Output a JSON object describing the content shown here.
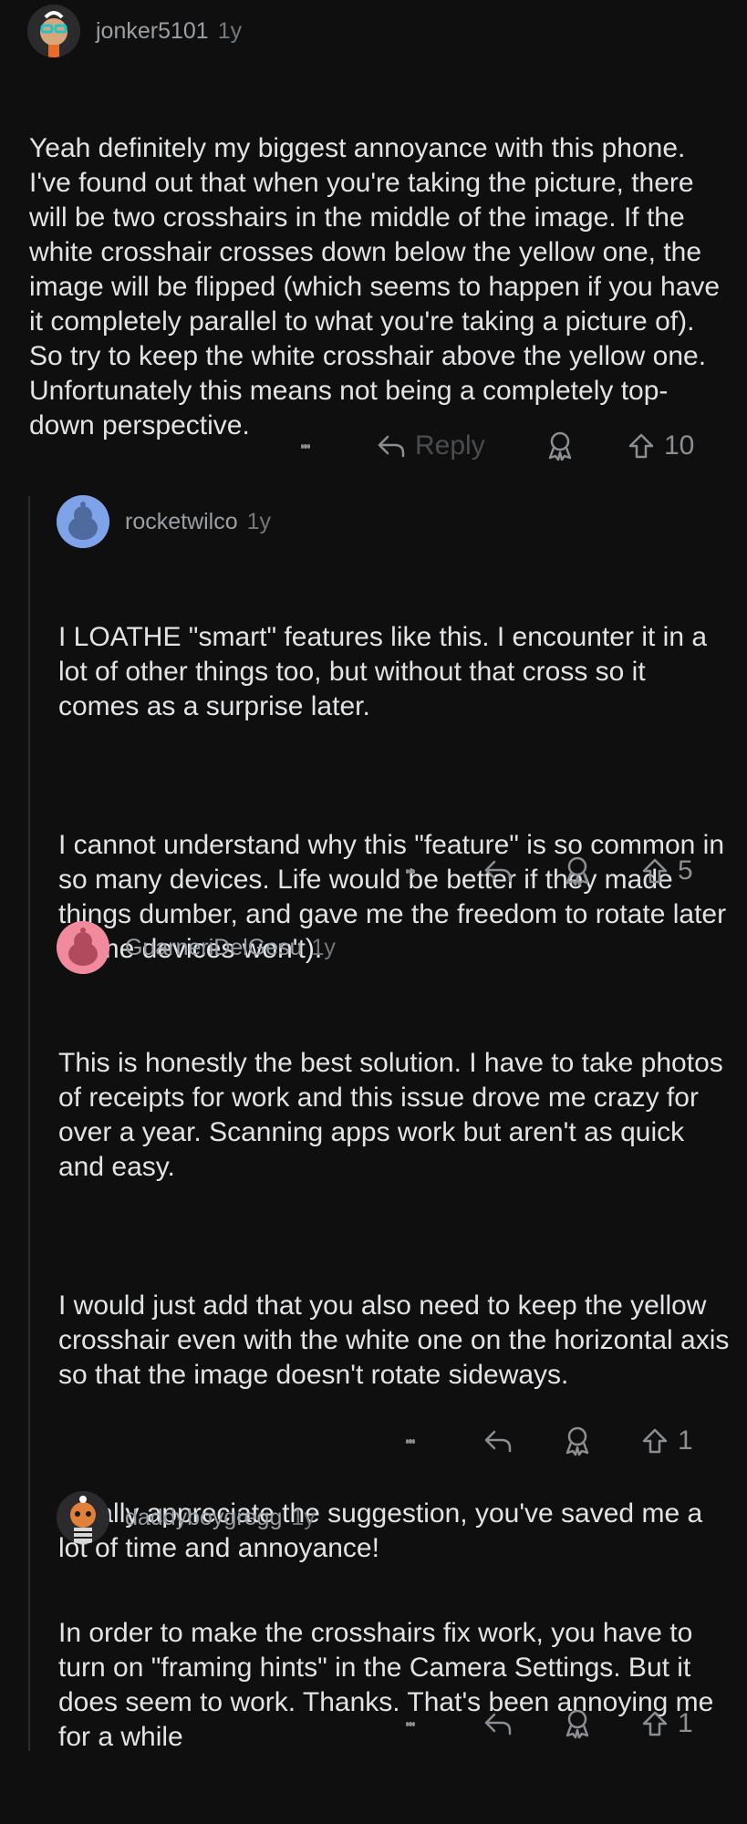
{
  "comments": [
    {
      "author": "jonker5101",
      "age": "1y",
      "body": [
        "Yeah definitely my biggest annoyance with this phone. I've found out that when you're taking the picture, there will be two crosshairs in the middle of the image. If the white crosshair crosses down below the yellow one, the image will be flipped (which seems to happen if you have it completely parallel to what you're taking a picture of). So try to keep the white crosshair above the yellow one. Unfortunately this means not being a completely top-down perspective."
      ],
      "reply_label": "Reply",
      "votes": "10"
    },
    {
      "author": "rocketwilco",
      "age": "1y",
      "body": [
        "I LOATHE \"smart\" features like this. I encounter it in a lot of other things too, but without that cross so it comes as a surprise later.",
        "I cannot understand why this \"feature\" is so common in so many devices. Life would be better if they made things dumber, and gave me the freedom to rotate later (some devices won't)."
      ],
      "votes": "5"
    },
    {
      "author": "GuarneriDelGesu",
      "age": "1y",
      "body": [
        "This is honestly the best solution. I have to take photos of receipts for work and this issue drove me crazy for over a year. Scanning apps work but aren't as quick and easy.",
        "I would just add that you also need to keep the yellow crosshair even with the white one on the horizontal axis so that the image doesn't rotate sideways.",
        "I really appreciate the suggestion, you've saved me a lot of time and annoyance!"
      ],
      "votes": "1"
    },
    {
      "author": "daddyboygregg",
      "age": "1y",
      "body": [
        "In order to make the crosshairs fix work, you have to turn on \"framing hints\" in the Camera Settings. But it does seem to work. Thanks. That's been annoying me for a while"
      ],
      "votes": "1"
    }
  ],
  "icons": {
    "more": "more-vertical-icon",
    "reply": "reply-arrow-icon",
    "award": "award-icon",
    "upvote": "upvote-arrow-icon"
  },
  "colors": {
    "background": "#0f0f10",
    "text": "#e1e3e5",
    "muted": "#8b8f93",
    "thread_line": "#2a2a2b"
  }
}
